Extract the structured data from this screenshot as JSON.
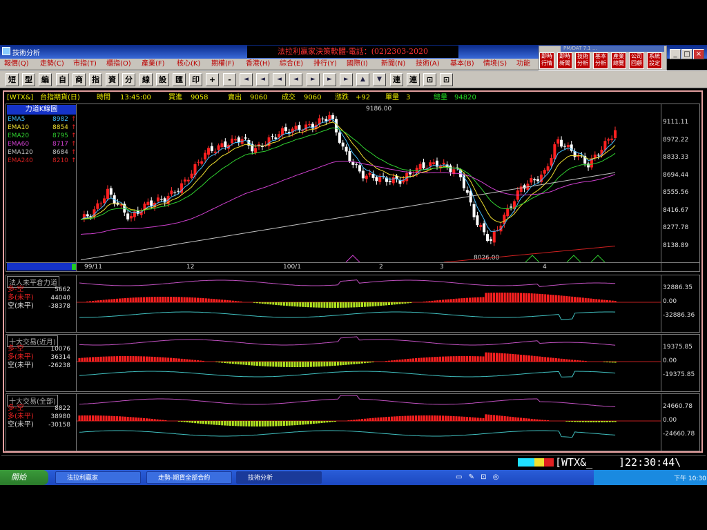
{
  "window": {
    "title": "技術分析",
    "banner": "法拉利贏家決策軟體-電話：(02)2303-2020"
  },
  "window_buttons": [
    "_",
    "□",
    "×"
  ],
  "side_panel": {
    "title": "PM/DAT 7.1 ...",
    "buttons": [
      "即時行情",
      "即時新聞",
      "技術分析",
      "基本分析",
      "產業總覽",
      "公司回顧",
      "系統設定"
    ]
  },
  "menu": [
    "報價(Q)",
    "走勢(C)",
    "市指(T)",
    "櫃指(O)",
    "產業(F)",
    "核心(K)",
    "期權(F)",
    "香港(H)",
    "綜合(E)",
    "排行(Y)",
    "國際(I)",
    "新聞(N)",
    "技術(A)",
    "基本(B)",
    "情境(S)",
    "功能"
  ],
  "toolbar": [
    "短",
    "型",
    "編",
    "自",
    "商",
    "指",
    "資",
    "分",
    "線",
    "設",
    "匯",
    "印",
    "+",
    "-",
    "◄",
    "◄",
    "◄",
    "◄",
    "►",
    "►",
    "►",
    "▲",
    "▼",
    "連",
    "連",
    "⊡",
    "⊡"
  ],
  "quote": {
    "symbol": "[WTX&]",
    "name": "台指期貨(日)",
    "time_label": "時間",
    "time": "13:45:00",
    "bid_label": "買進",
    "bid": "9058",
    "ask_label": "賣出",
    "ask": "9060",
    "last_label": "成交",
    "last": "9060",
    "chg_label": "漲跌",
    "chg": "+92",
    "vol_label": "單量",
    "vol": "3",
    "total_label": "總量",
    "total": "94820"
  },
  "kline": {
    "title": "力道K線圖",
    "legend": [
      {
        "name": "EMA5",
        "value": "8982",
        "color": "#44c0ff"
      },
      {
        "name": "EMA10",
        "value": "8854",
        "color": "#f0e030"
      },
      {
        "name": "EMA20",
        "value": "8795",
        "color": "#30d030"
      },
      {
        "name": "EMA60",
        "value": "8717",
        "color": "#d040d0"
      },
      {
        "name": "EMA120",
        "value": "8684",
        "color": "#c0c0c0"
      },
      {
        "name": "EMA240",
        "value": "8210",
        "color": "#d02020"
      }
    ],
    "high_label": "9186.00",
    "low_label": "8026.00",
    "yaxis": [
      "9111.11",
      "8972.22",
      "8833.33",
      "8694.44",
      "8555.56",
      "8416.67",
      "8277.78",
      "8138.89"
    ],
    "xaxis": [
      "99/11",
      "12",
      "100/1",
      "2",
      "3",
      "4"
    ]
  },
  "panels": [
    {
      "title": "法人未平倉力道",
      "rows": [
        {
          "label": "多-空",
          "value": "5662"
        },
        {
          "label": "多(未平)",
          "value": "44040"
        },
        {
          "label": "空(未平)",
          "value": "-38378"
        }
      ],
      "axis": [
        "32886.35",
        "0.00",
        "-32886.36"
      ]
    },
    {
      "title": "十大交易(近月)",
      "rows": [
        {
          "label": "多-空",
          "value": "10076"
        },
        {
          "label": "多(未平)",
          "value": "36314"
        },
        {
          "label": "空(未平)",
          "value": "-26238"
        }
      ],
      "axis": [
        "19375.85",
        "0.00",
        "-19375.85"
      ]
    },
    {
      "title": "十大交易(全部)",
      "rows": [
        {
          "label": "多-空",
          "value": "8822"
        },
        {
          "label": "多(未平)",
          "value": "38980"
        },
        {
          "label": "空(未平)",
          "value": "-30158"
        }
      ],
      "axis": [
        "24660.78",
        "0.00",
        "-24660.78"
      ]
    }
  ],
  "status": {
    "symbol": "[WTX&_",
    "clock": "]22:30:44\\"
  },
  "taskbar": {
    "start": "開始",
    "tasks": [
      "法拉利贏家",
      "走勢-期貨全部合約",
      "技術分析"
    ],
    "clock": "下午 10:30"
  }
}
